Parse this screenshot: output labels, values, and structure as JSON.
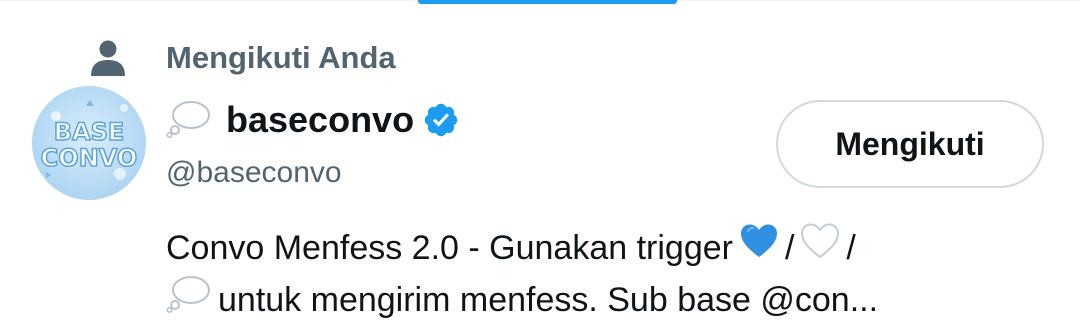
{
  "context": {
    "label": "Mengikuti Anda",
    "icon": "person-icon"
  },
  "user": {
    "display_name": "baseconvo",
    "name_prefix_icon": "thought-bubble-icon",
    "verified_icon": "verified-badge-icon",
    "handle": "@baseconvo",
    "avatar_text": "BASE CONVO"
  },
  "follow_button": {
    "label": "Mengikuti"
  },
  "bio": {
    "line1_text": "Convo Menfess 2.0 - Gunakan trigger",
    "line1_sep1": "/",
    "line1_sep2": "/",
    "line2_text": "untuk mengirim menfess. Sub base @con...",
    "emojis": [
      "blue-heart-icon",
      "white-heart-icon",
      "thought-bubble-icon"
    ]
  },
  "colors": {
    "accent": "#1d9bf0",
    "text_primary": "#0f1419",
    "text_secondary": "#536471",
    "border": "#cfd9de"
  }
}
